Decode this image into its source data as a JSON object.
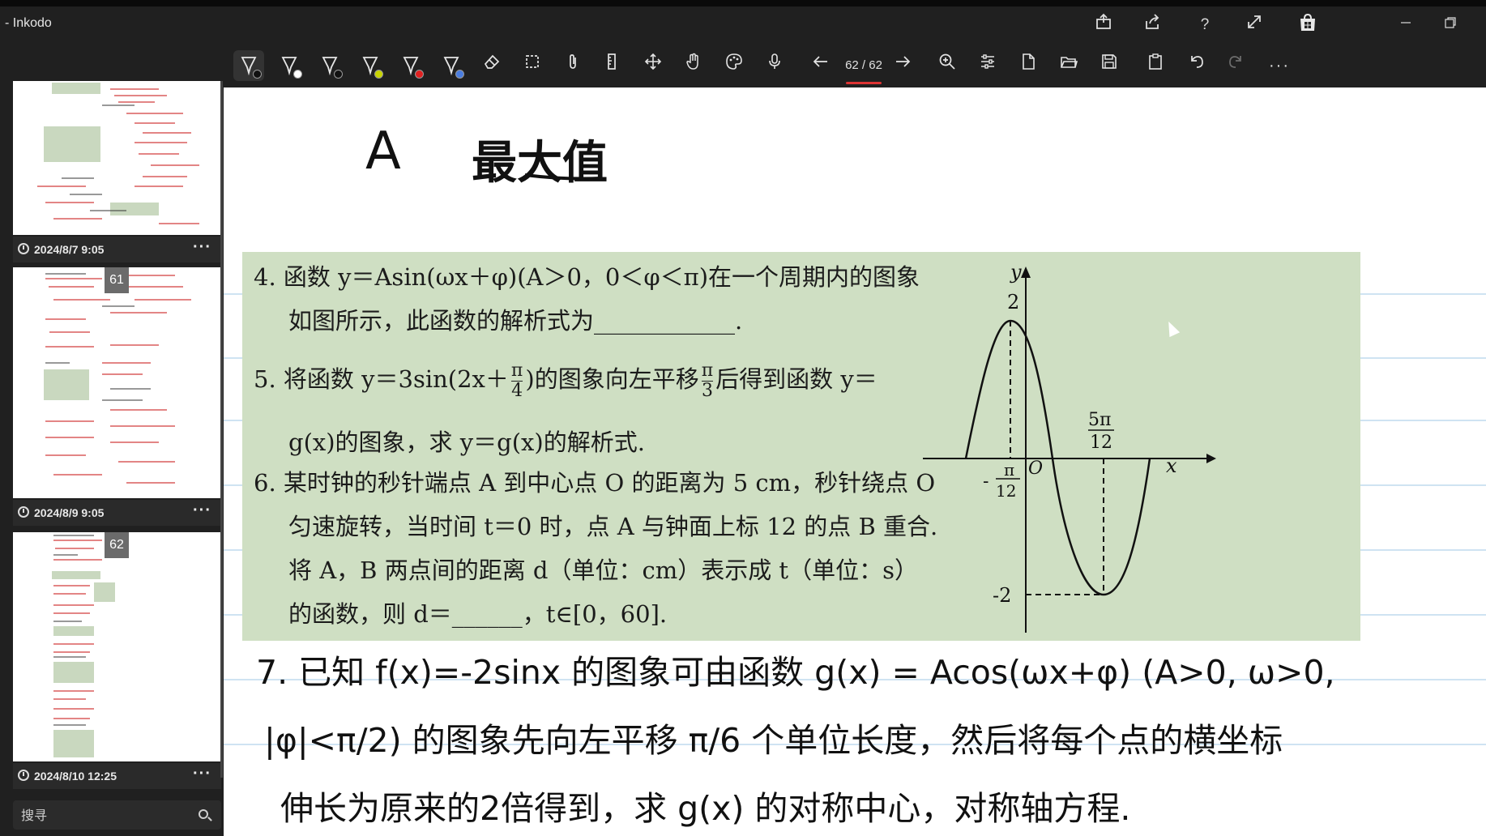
{
  "window": {
    "title": "- Inkodo"
  },
  "titlebar_icons": [
    "share-out-icon",
    "share-icon",
    "help-icon",
    "fullscreen-icon",
    "store-icon",
    "minimize-icon",
    "restore-icon"
  ],
  "toolbar": {
    "pens": [
      {
        "name": "pen-black",
        "color": "#111111"
      },
      {
        "name": "pen-white",
        "color": "#ffffff"
      },
      {
        "name": "pen-black-2",
        "color": "#111111"
      },
      {
        "name": "pen-yellow",
        "color": "#c8d400"
      },
      {
        "name": "pen-red",
        "color": "#e02020"
      },
      {
        "name": "pen-blue",
        "color": "#4a7de0"
      }
    ],
    "page_indicator": "62 / 62"
  },
  "sidebar": {
    "pages": [
      {
        "date": "2024/8/7 9:05",
        "badge": ""
      },
      {
        "date": "2024/8/9 9:05",
        "badge": "61"
      },
      {
        "date": "2024/8/10 12:25",
        "badge": "62"
      }
    ],
    "search_placeholder": "搜寻"
  },
  "canvas": {
    "heading_a": "A",
    "heading_b": "最大值",
    "problems": {
      "p4_line1": "4. 函数 y＝Asin(ωx＋φ)(A＞0，0＜φ＜π)在一个周期内的图象",
      "p4_line2": "如图所示，此函数的解析式为____________.",
      "p5_line1_a": "5. 将函数 y＝3sin(2x＋",
      "p5_frac1_num": "π",
      "p5_frac1_den": "4",
      "p5_line1_b": ")的图象向左平移",
      "p5_frac2_num": "π",
      "p5_frac2_den": "3",
      "p5_line1_c": "后得到函数 y＝",
      "p5_line2": "g(x)的图象，求 y＝g(x)的解析式.",
      "p6_line1": "6. 某时钟的秒针端点 A 到中心点 O 的距离为 5 cm，秒针绕点 O",
      "p6_line2": "匀速旋转，当时间 t＝0 时，点 A 与钟面上标 12 的点 B 重合.",
      "p6_line3": "将 A，B 两点间的距离 d（单位：cm）表示成 t（单位：s）",
      "p6_line4": "的函数，则 d＝______，t∈[0，60]."
    },
    "graph_labels": {
      "y_axis": "y",
      "x_axis": "x",
      "origin": "O",
      "max": "2",
      "min": "-2",
      "neg_num": "π",
      "neg_den": "12",
      "neg_sign": "-",
      "pos_num": "5π",
      "pos_den": "12"
    },
    "handwritten": {
      "line1": "7. 已知 f(x)=-2sinx 的图象可由函数 g(x) = Acos(ωx+φ) (A>0, ω>0,",
      "line2": "|φ|<π/2) 的图象先向左平移 π/6 个单位长度，然后将每个点的横坐标",
      "line3": "伸长为原来的2倍得到，求 g(x) 的对称中心，对称轴方程."
    }
  }
}
